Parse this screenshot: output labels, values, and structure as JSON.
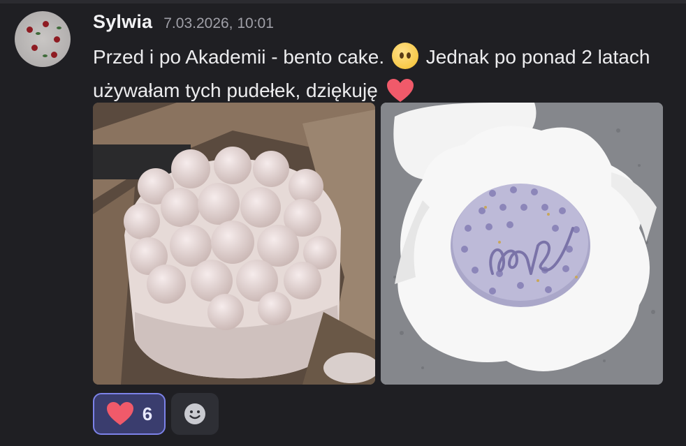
{
  "message": {
    "author": "Sylwia",
    "timestamp": "7.03.2026, 10:01",
    "text_part1": "Przed i po Akademii - bento cake.",
    "text_part2": "Jednak po ponad 2 latach używałam tych pudełek, dziękuję",
    "emoji_1": "face-without-mouth-emoji",
    "emoji_2": "red-heart-emoji"
  },
  "attachments": [
    {
      "name": "photo-cake-meringue",
      "description": "white meringue-topped cake in paper"
    },
    {
      "name": "photo-bento-cake-love",
      "description": "lavender bento cake with love inscription in box"
    }
  ],
  "reactions": [
    {
      "emoji": "red-heart",
      "count": "6",
      "active": true
    }
  ],
  "add_reaction": {
    "icon": "smiley-add-icon"
  },
  "colors": {
    "background": "#1f1f23",
    "reaction_active_border": "#7c82e8",
    "reaction_active_bg": "#3a3d6e",
    "heart": "#f05a6a"
  }
}
